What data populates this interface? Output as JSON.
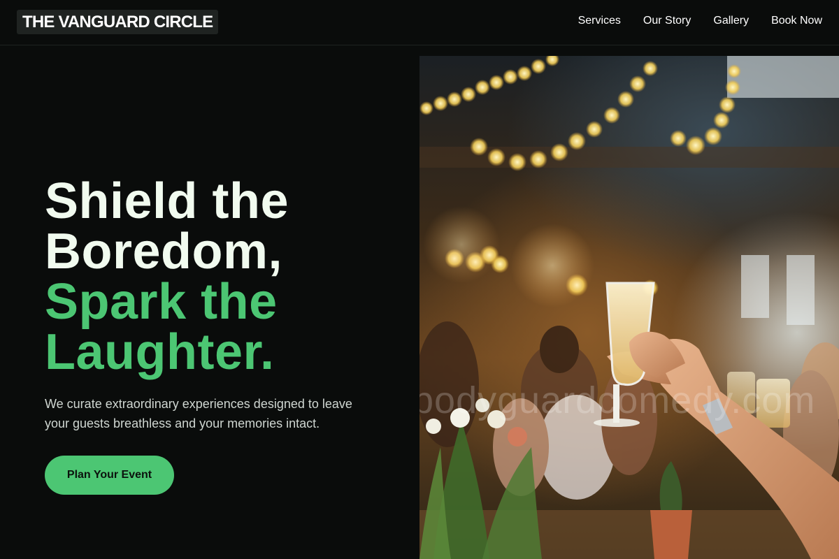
{
  "brand": {
    "name": "THE VANGUARD CIRCLE"
  },
  "nav": {
    "items": [
      {
        "label": "Services"
      },
      {
        "label": "Our Story"
      },
      {
        "label": "Gallery"
      },
      {
        "label": "Book Now"
      }
    ]
  },
  "hero": {
    "title_line_1": "Shield the",
    "title_line_2": "Boredom,",
    "title_line_3": "Spark the",
    "title_line_4": "Laughter.",
    "subtitle": "We curate extraordinary experiences designed to leave your guests breathless and your memories intact.",
    "cta_label": "Plan Your Event",
    "image_watermark": "bodyguardcomedy.com"
  },
  "colors": {
    "background": "#0a0c0b",
    "accent": "#4cc673",
    "headline": "#f1fbef",
    "body_text": "#cfd6d1"
  }
}
